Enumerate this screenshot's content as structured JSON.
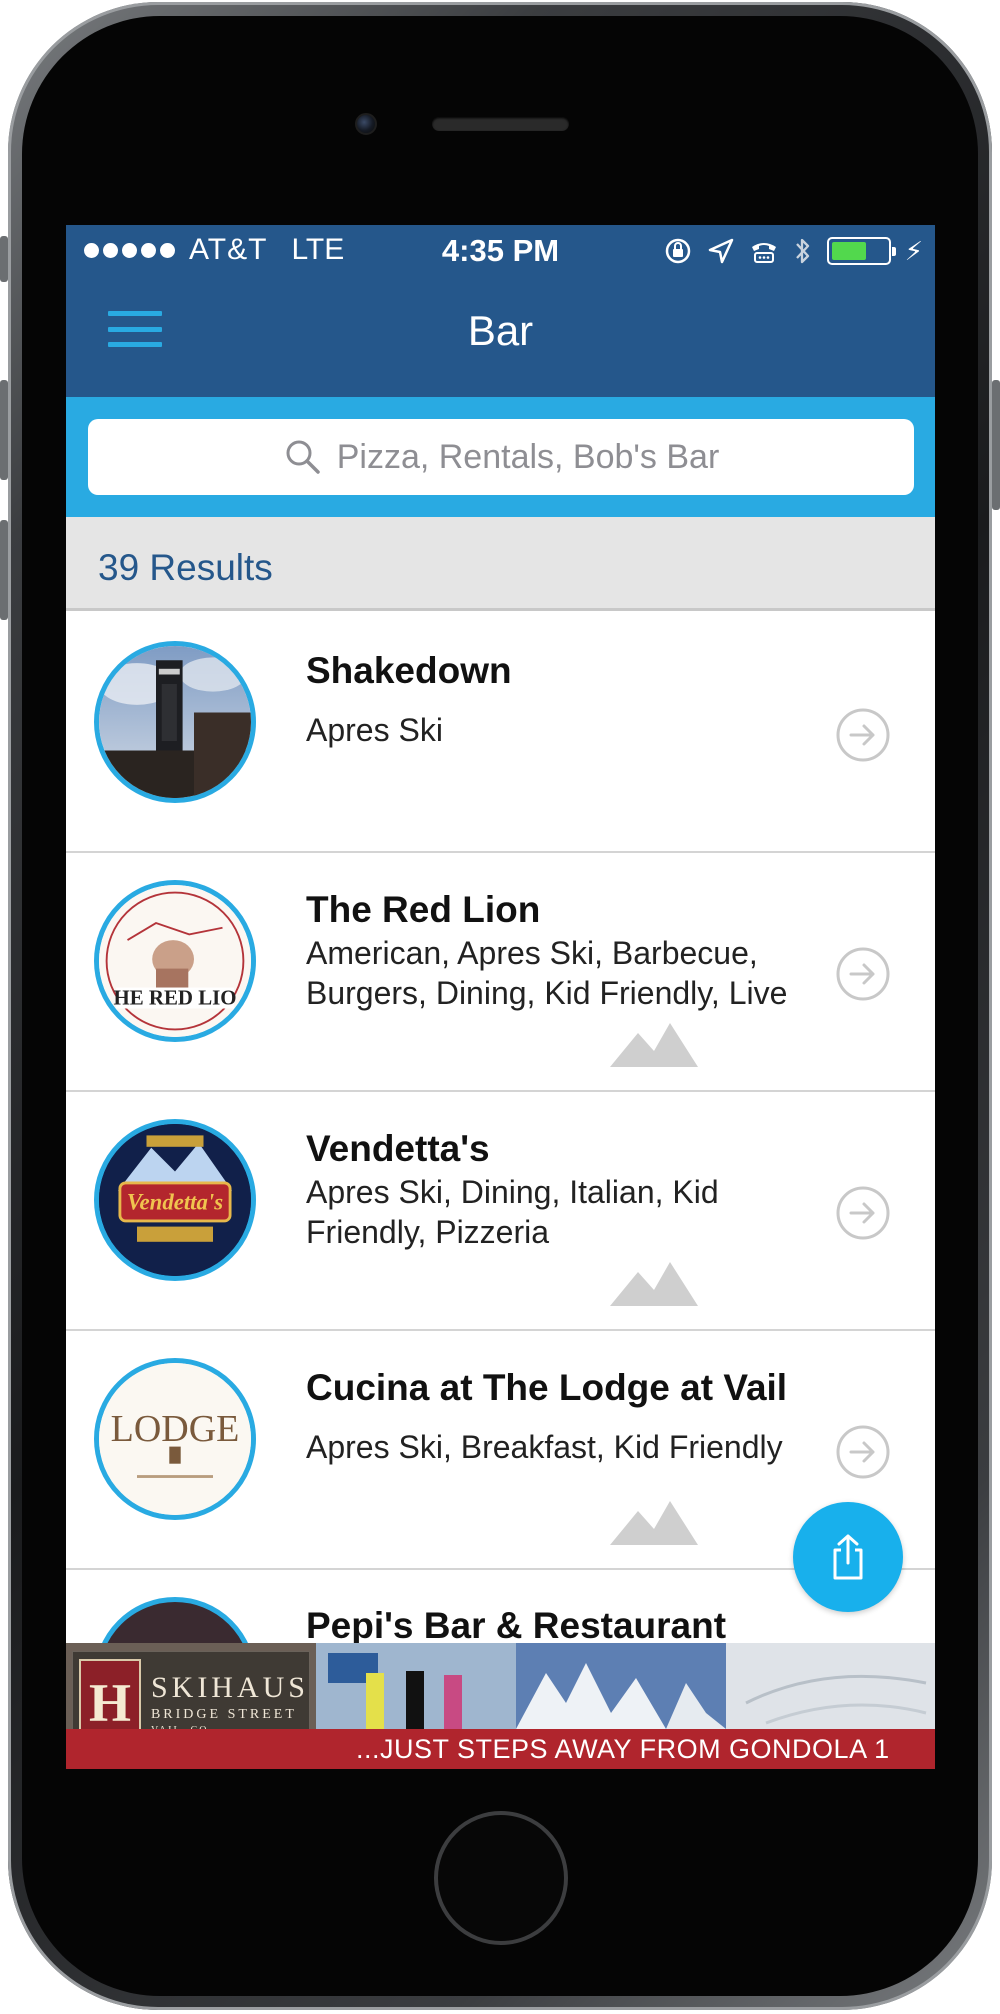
{
  "status_bar": {
    "carrier": "AT&T",
    "network": "LTE",
    "time": "4:35 PM",
    "battery_color": "#52d84d"
  },
  "nav": {
    "title": "Bar",
    "menu_icon": "hamburger-menu-icon"
  },
  "search": {
    "placeholder": "Pizza, Rentals, Bob's Bar"
  },
  "results": {
    "count_label": "39 Results"
  },
  "items": [
    {
      "title": "Shakedown",
      "tags": "Apres Ski"
    },
    {
      "title": "The Red Lion",
      "tags": "American, Apres Ski, Barbecue, Burgers, Dining, Kid Friendly, Live"
    },
    {
      "title": "Vendetta's",
      "tags": "Apres Ski, Dining, Italian, Kid Friendly, Pizzeria"
    },
    {
      "title": "Cucina at The Lodge at Vail",
      "tags": "Apres Ski, Breakfast, Kid Friendly"
    },
    {
      "title": "Pepi's Bar & Restaurant",
      "tags": ""
    }
  ],
  "ad": {
    "brand": "SKIHAUS",
    "sub": "BRIDGE STREET",
    "location": "VAIL, CO",
    "tagline": "...JUST STEPS AWAY FROM GONDOLA 1"
  },
  "colors": {
    "nav_blue": "#25578b",
    "accent_cyan": "#29aae2",
    "results_band": "#e5e5e5",
    "ad_red": "#b0252d"
  }
}
